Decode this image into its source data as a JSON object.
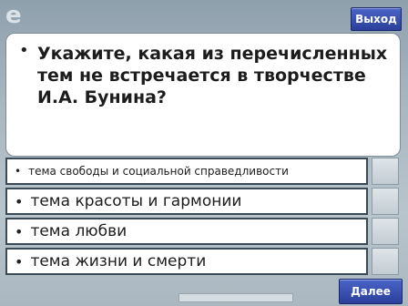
{
  "header": {
    "logo_text": "e",
    "exit_label": "Выход"
  },
  "question": {
    "bullet": "•",
    "text": "Укажите, какая из перечисленных тем не встречается в творчестве И.А. Бунина?"
  },
  "answers": [
    {
      "bullet": "•",
      "text": "тема свободы и социальной справедливости"
    },
    {
      "bullet": "•",
      "text": "тема красоты и гармонии"
    },
    {
      "bullet": "•",
      "text": "тема любви"
    },
    {
      "bullet": "•",
      "text": "тема жизни и смерти"
    }
  ],
  "footer": {
    "next_label": "Далее"
  },
  "colors": {
    "accent": "#2b3f9a",
    "panel": "#ffffff",
    "background": "#a9b7c1"
  }
}
